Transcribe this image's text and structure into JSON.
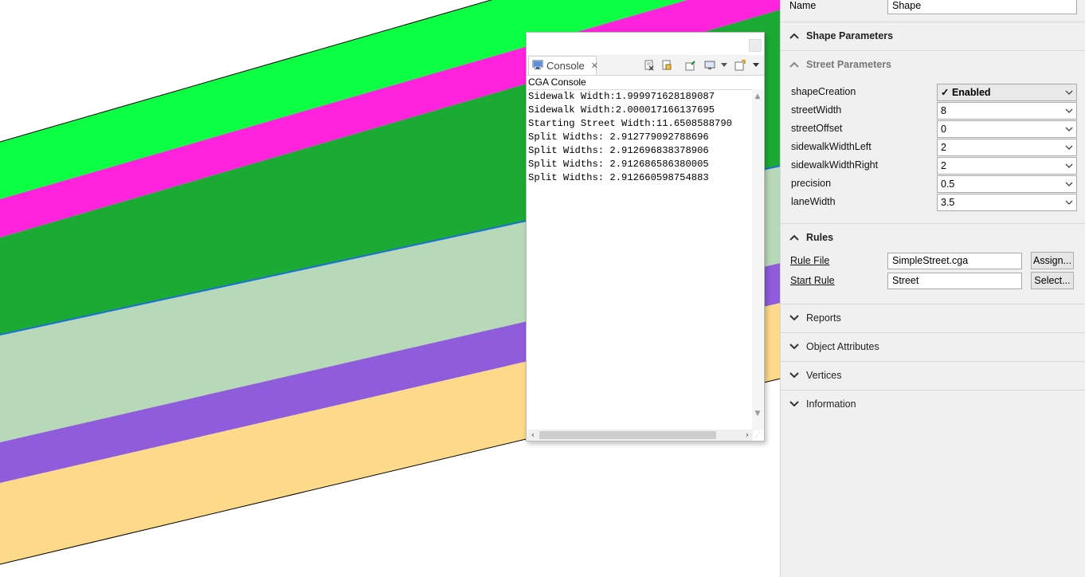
{
  "viewport": {
    "colors": {
      "green_bright": "#0dff44",
      "magenta": "#ff22dd",
      "green_dark": "#1bab34",
      "sage": "#b8d9b8",
      "purple": "#8f5cdc",
      "tan": "#fdd98a",
      "background": "#ffffff"
    }
  },
  "console": {
    "tab_label": "Console",
    "subtitle": "CGA Console",
    "lines": [
      "Sidewalk Width:1.999971628189087",
      "Sidewalk Width:2.000017166137695",
      "Starting Street Width:11.6508588790",
      "Split Widths: 2.912779092788696",
      "Split Widths: 2.912696838378906",
      "Split Widths: 2.912686586380005",
      "Split Widths: 2.912660598754883"
    ]
  },
  "inspector": {
    "name_label": "Name",
    "name_value": "Shape",
    "shape_parameters_title": "Shape Parameters",
    "street_parameters_title": "Street Parameters",
    "params": [
      {
        "label": "shapeCreation",
        "value": "✓ Enabled"
      },
      {
        "label": "streetWidth",
        "value": "8"
      },
      {
        "label": "streetOffset",
        "value": "0"
      },
      {
        "label": "sidewalkWidthLeft",
        "value": "2"
      },
      {
        "label": "sidewalkWidthRight",
        "value": "2"
      },
      {
        "label": "precision",
        "value": "0.5"
      },
      {
        "label": "laneWidth",
        "value": "3.5"
      }
    ],
    "rules_title": "Rules",
    "rule_file_label": "Rule File",
    "rule_file_value": "SimpleStreet.cga",
    "assign_label": "Assign...",
    "start_rule_label": "Start Rule",
    "start_rule_value": "Street",
    "select_label": "Select...",
    "collapsed_sections": [
      "Reports",
      "Object Attributes",
      "Vertices",
      "Information"
    ]
  }
}
